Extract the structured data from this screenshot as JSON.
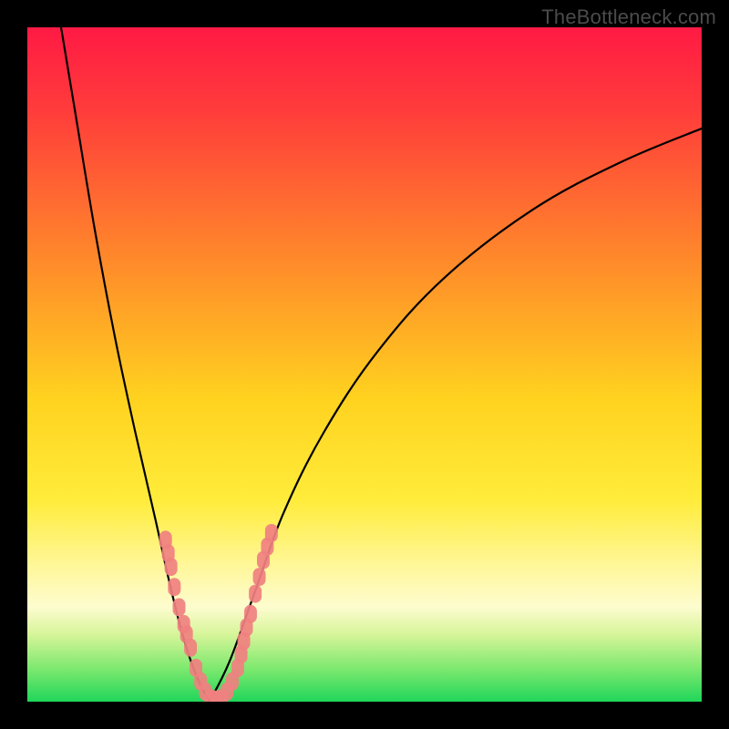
{
  "watermark": "TheBottleneck.com",
  "chart_data": {
    "type": "line",
    "title": "",
    "xlabel": "",
    "ylabel": "",
    "xlim": [
      0,
      100
    ],
    "ylim": [
      0,
      100
    ],
    "gradient_stops": [
      {
        "pct": 0,
        "color": "#ff1a44"
      },
      {
        "pct": 12,
        "color": "#ff3b3b"
      },
      {
        "pct": 35,
        "color": "#ff8b2a"
      },
      {
        "pct": 55,
        "color": "#ffd21f"
      },
      {
        "pct": 70,
        "color": "#ffec3a"
      },
      {
        "pct": 80,
        "color": "#fff79b"
      },
      {
        "pct": 86,
        "color": "#fdfccf"
      },
      {
        "pct": 90,
        "color": "#d7f59a"
      },
      {
        "pct": 95,
        "color": "#7fe96f"
      },
      {
        "pct": 100,
        "color": "#1fd65a"
      }
    ],
    "series": [
      {
        "name": "left-curve",
        "type": "line",
        "color": "#000000",
        "points": [
          {
            "x": 5,
            "y": 100
          },
          {
            "x": 7,
            "y": 88
          },
          {
            "x": 10,
            "y": 70
          },
          {
            "x": 13,
            "y": 54
          },
          {
            "x": 16,
            "y": 40
          },
          {
            "x": 19,
            "y": 27
          },
          {
            "x": 21,
            "y": 18
          },
          {
            "x": 23,
            "y": 10
          },
          {
            "x": 25,
            "y": 4
          },
          {
            "x": 27,
            "y": 0
          }
        ]
      },
      {
        "name": "right-curve",
        "type": "line",
        "color": "#000000",
        "points": [
          {
            "x": 27,
            "y": 0
          },
          {
            "x": 30,
            "y": 6
          },
          {
            "x": 34,
            "y": 17
          },
          {
            "x": 38,
            "y": 28
          },
          {
            "x": 44,
            "y": 40
          },
          {
            "x": 52,
            "y": 52
          },
          {
            "x": 62,
            "y": 63
          },
          {
            "x": 75,
            "y": 73
          },
          {
            "x": 88,
            "y": 80
          },
          {
            "x": 100,
            "y": 85
          }
        ]
      },
      {
        "name": "left-markers",
        "type": "scatter",
        "color": "#f08080",
        "points": [
          {
            "x": 20.5,
            "y": 24
          },
          {
            "x": 20.9,
            "y": 22
          },
          {
            "x": 21.3,
            "y": 20
          },
          {
            "x": 21.8,
            "y": 17
          },
          {
            "x": 22.5,
            "y": 14
          },
          {
            "x": 23.2,
            "y": 11.5
          },
          {
            "x": 23.6,
            "y": 10
          },
          {
            "x": 24.2,
            "y": 8
          },
          {
            "x": 25.0,
            "y": 5
          },
          {
            "x": 25.7,
            "y": 3
          },
          {
            "x": 26.4,
            "y": 1.5
          },
          {
            "x": 27.2,
            "y": 0.5
          },
          {
            "x": 28.0,
            "y": 0.3
          },
          {
            "x": 28.8,
            "y": 0.5
          }
        ]
      },
      {
        "name": "right-markers",
        "type": "scatter",
        "color": "#f08080",
        "points": [
          {
            "x": 29.6,
            "y": 1.5
          },
          {
            "x": 30.4,
            "y": 3
          },
          {
            "x": 31.2,
            "y": 5
          },
          {
            "x": 31.7,
            "y": 7
          },
          {
            "x": 32.1,
            "y": 9
          },
          {
            "x": 32.5,
            "y": 11
          },
          {
            "x": 33.1,
            "y": 13
          },
          {
            "x": 33.8,
            "y": 16
          },
          {
            "x": 34.4,
            "y": 18.5
          },
          {
            "x": 35.0,
            "y": 21
          },
          {
            "x": 35.6,
            "y": 23
          },
          {
            "x": 36.2,
            "y": 25
          }
        ]
      }
    ]
  }
}
